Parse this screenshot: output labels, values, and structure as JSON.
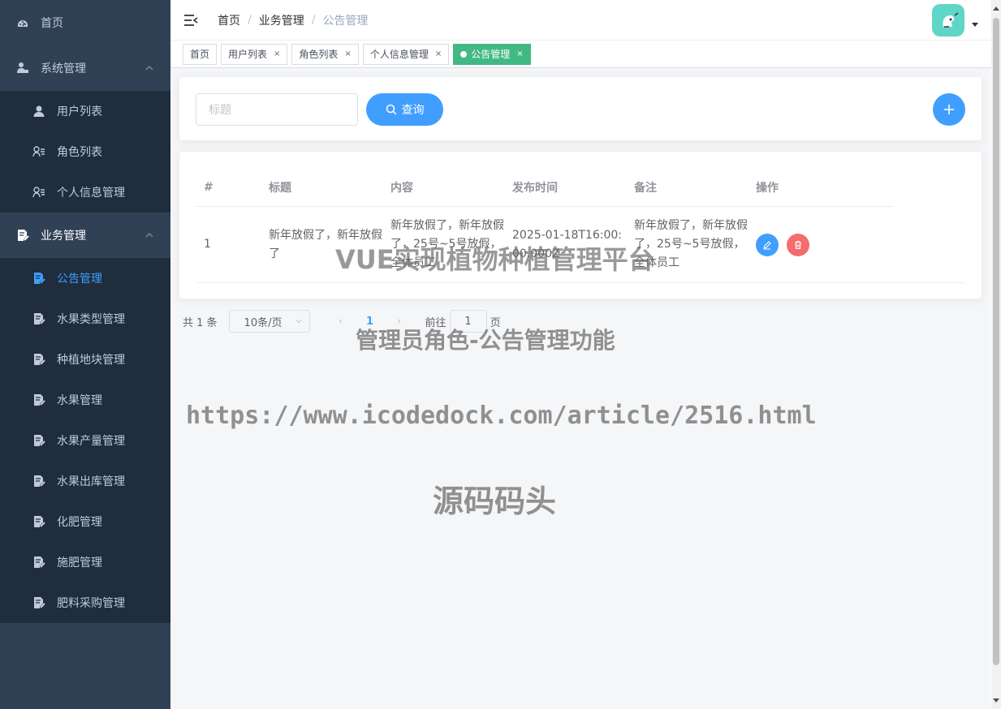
{
  "sidebar": {
    "items": [
      {
        "label": "首页",
        "icon": "dashboard-icon"
      },
      {
        "label": "系统管理",
        "icon": "user-lock-icon"
      },
      {
        "label": "业务管理",
        "icon": "doc-edit-icon"
      }
    ],
    "system_sub": [
      {
        "label": "用户列表",
        "icon": "user-icon"
      },
      {
        "label": "角色列表",
        "icon": "user-list-icon"
      },
      {
        "label": "个人信息管理",
        "icon": "user-list-icon"
      }
    ],
    "business_sub": [
      {
        "label": "公告管理",
        "icon": "doc-edit-icon",
        "active": true
      },
      {
        "label": "水果类型管理",
        "icon": "doc-edit-icon"
      },
      {
        "label": "种植地块管理",
        "icon": "doc-edit-icon"
      },
      {
        "label": "水果管理",
        "icon": "doc-edit-icon"
      },
      {
        "label": "水果产量管理",
        "icon": "doc-edit-icon"
      },
      {
        "label": "水果出库管理",
        "icon": "doc-edit-icon"
      },
      {
        "label": "化肥管理",
        "icon": "doc-edit-icon"
      },
      {
        "label": "施肥管理",
        "icon": "doc-edit-icon"
      },
      {
        "label": "肥料采购管理",
        "icon": "doc-edit-icon"
      }
    ]
  },
  "breadcrumb": [
    "首页",
    "业务管理",
    "公告管理"
  ],
  "tabs": [
    {
      "label": "首页"
    },
    {
      "label": "用户列表"
    },
    {
      "label": "角色列表"
    },
    {
      "label": "个人信息管理"
    },
    {
      "label": "公告管理",
      "active": true
    }
  ],
  "search": {
    "placeholder": "标题",
    "query_label": "查询"
  },
  "table": {
    "headers": [
      "#",
      "标题",
      "内容",
      "发布时间",
      "备注",
      "操作"
    ],
    "rows": [
      {
        "index": "1",
        "title": "新年放假了，新年放假了",
        "content": "新年放假了，新年放假了，25号~5号放假，全体员工",
        "time": "2025-01-18T16:00:00.000Z",
        "remark": "新年放假了，新年放假了，25号~5号放假，全体员工"
      }
    ]
  },
  "pagination": {
    "total": "共 1 条",
    "page_size": "10条/页",
    "current": "1",
    "goto_prefix": "前往",
    "goto_value": "1",
    "goto_suffix": "页"
  },
  "watermarks": {
    "line1": "VUE实现植物种植管理平台",
    "line2": "管理员角色-公告管理功能",
    "line3": "https://www.icodedock.com/article/2516.html",
    "line4": "源码码头"
  },
  "colors": {
    "sidebar_bg": "#304156",
    "submenu_bg": "#1f2d3d",
    "primary": "#409eff",
    "danger": "#f56c6c",
    "active_tag": "#42b983"
  }
}
